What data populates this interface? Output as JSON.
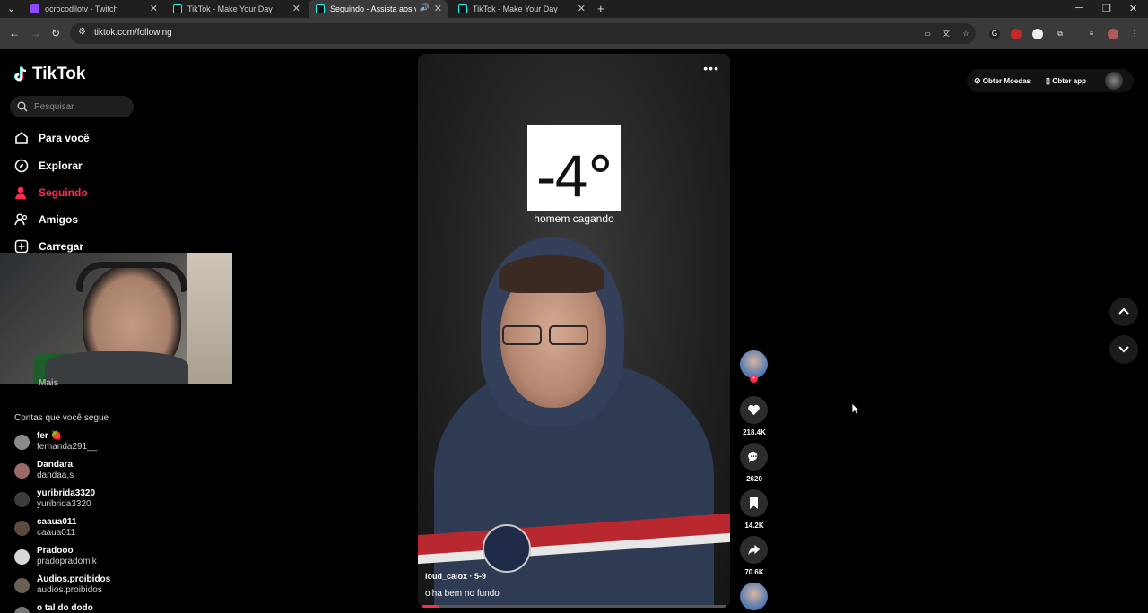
{
  "browser": {
    "tabs": [
      {
        "title": "ocrocodilotv - Twitch",
        "favicon_color": "#9146ff",
        "active": false
      },
      {
        "title": "TikTok - Make Your Day",
        "favicon_color": "#25f4ee",
        "active": false
      },
      {
        "title": "Seguindo - Assista aos víde",
        "favicon_color": "#25f4ee",
        "active": true
      },
      {
        "title": "TikTok - Make Your Day",
        "favicon_color": "#25f4ee",
        "active": false
      }
    ],
    "new_tab": "+",
    "url": "tiktok.com/following"
  },
  "sidebar": {
    "logo": "TikTok",
    "search_placeholder": "Pesquisar",
    "nav": [
      {
        "label": "Para você",
        "icon": "home-icon"
      },
      {
        "label": "Explorar",
        "icon": "compass-icon"
      },
      {
        "label": "Seguindo",
        "icon": "following-icon",
        "active": true
      },
      {
        "label": "Amigos",
        "icon": "friends-icon"
      },
      {
        "label": "Carregar",
        "icon": "upload-icon"
      }
    ],
    "more_label": "Mais",
    "following_title": "Contas que você segue",
    "accounts": [
      {
        "name": "fer 🍓",
        "handle": "fernanda291__"
      },
      {
        "name": "Dandara",
        "handle": "dandaa.s"
      },
      {
        "name": "yuribrida3320",
        "handle": "yuribrida3320"
      },
      {
        "name": "caaua011",
        "handle": "caaua011"
      },
      {
        "name": "Pradooo",
        "handle": "pradopradomlk"
      },
      {
        "name": "Áudios.proibidos",
        "handle": "audios.proibidos"
      },
      {
        "name": "o tal do dodo",
        "handle": ""
      }
    ]
  },
  "video": {
    "temperature": "-4°",
    "overlay_caption": "homem cagando",
    "author": "loud_caiox · 5-9",
    "description": "olha bem no fundo",
    "progress": 0.06
  },
  "actions": {
    "likes": "218.4K",
    "comments": "2620",
    "saves": "14.2K",
    "shares": "70.6K"
  },
  "topbar": {
    "coins_label": "Obter Moedas",
    "app_label": "Obter app"
  },
  "colors": {
    "accent": "#fe2c55",
    "bg": "#000000"
  }
}
